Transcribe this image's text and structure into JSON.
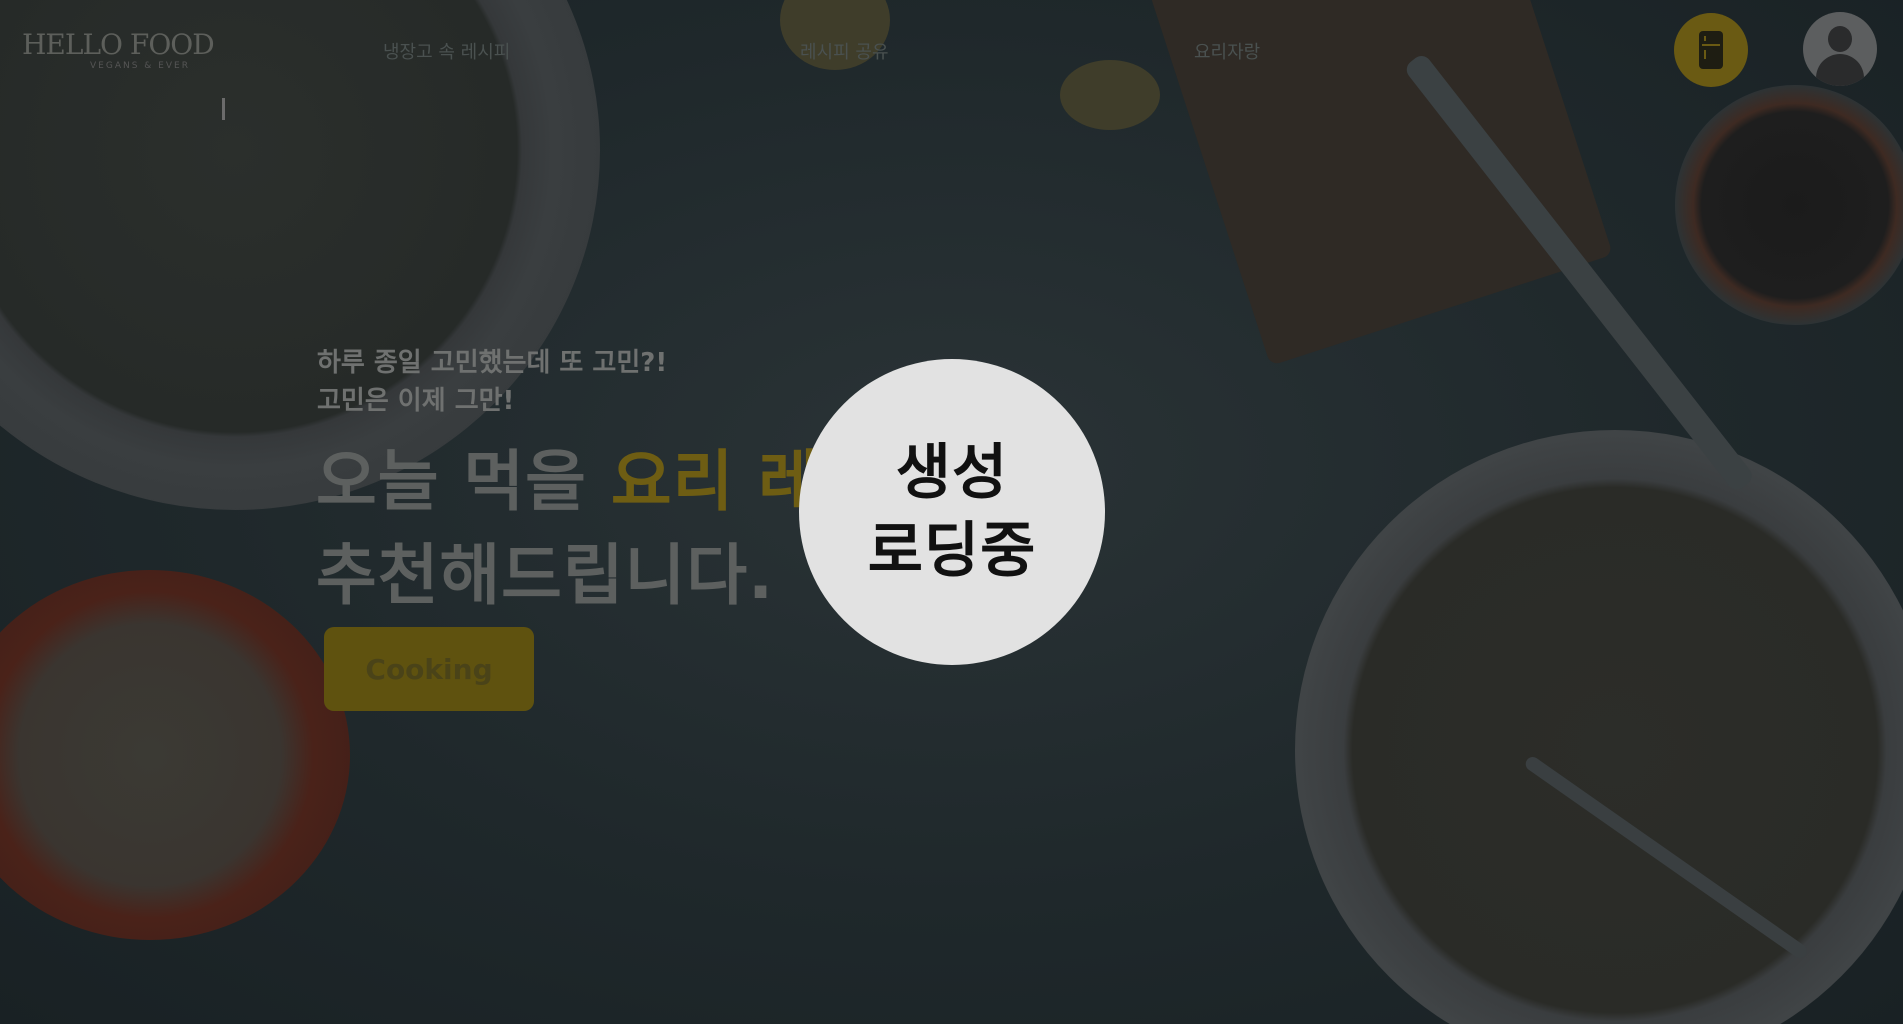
{
  "header": {
    "logo": "HELLO FOOD",
    "logo_sub": "VEGANS & EVER",
    "nav": [
      "냉장고 속 레시피",
      "레시피 공유",
      "요리자랑"
    ],
    "fridge_icon": "fridge-icon",
    "profile_icon": "user-avatar-icon"
  },
  "hero": {
    "subtitle_1": "하루 종일 고민했는데 또 고민?!",
    "subtitle_2": "고민은 이제 그만!",
    "title_1_prefix": "오늘 먹을 ",
    "title_1_highlight": "요리 레시피를",
    "title_2": "추천해드립니다.",
    "cta_label": "Cooking"
  },
  "loading": {
    "line_1": "생성",
    "line_2": "로딩중"
  },
  "colors": {
    "accent": "#f5c800",
    "overlay": "rgba(0,0,0,0.7)",
    "loader_bg": "#e2e2e2"
  }
}
